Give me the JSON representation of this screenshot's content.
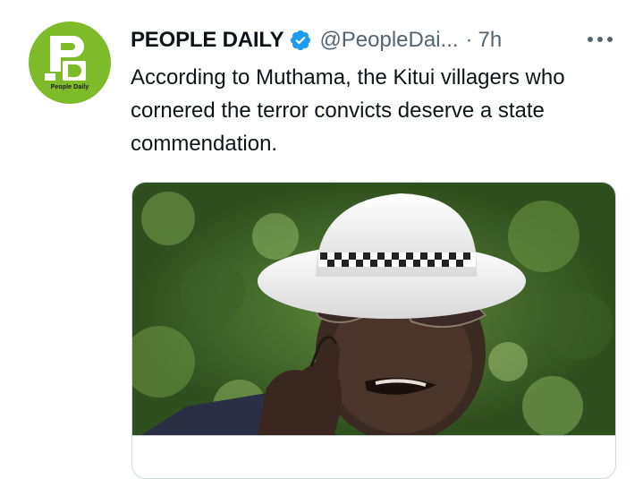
{
  "author": {
    "display_name": "PEOPLE DAILY",
    "handle": "@PeopleDai...",
    "separator": "·",
    "time": "7h",
    "avatar_brand": "People Daily",
    "avatar_color": "#7dbb2a",
    "verified_icon": "verified-badge-icon",
    "verified_color": "#1d9bf0"
  },
  "tweet": {
    "text": "According to Muthama, the Kitui villagers who cornered the terror convicts deserve a state commendation."
  },
  "more_icon": "more-options-icon",
  "card": {
    "image_subject": "man wearing white hat and tinted sunglasses pointing finger, leafy green background"
  }
}
